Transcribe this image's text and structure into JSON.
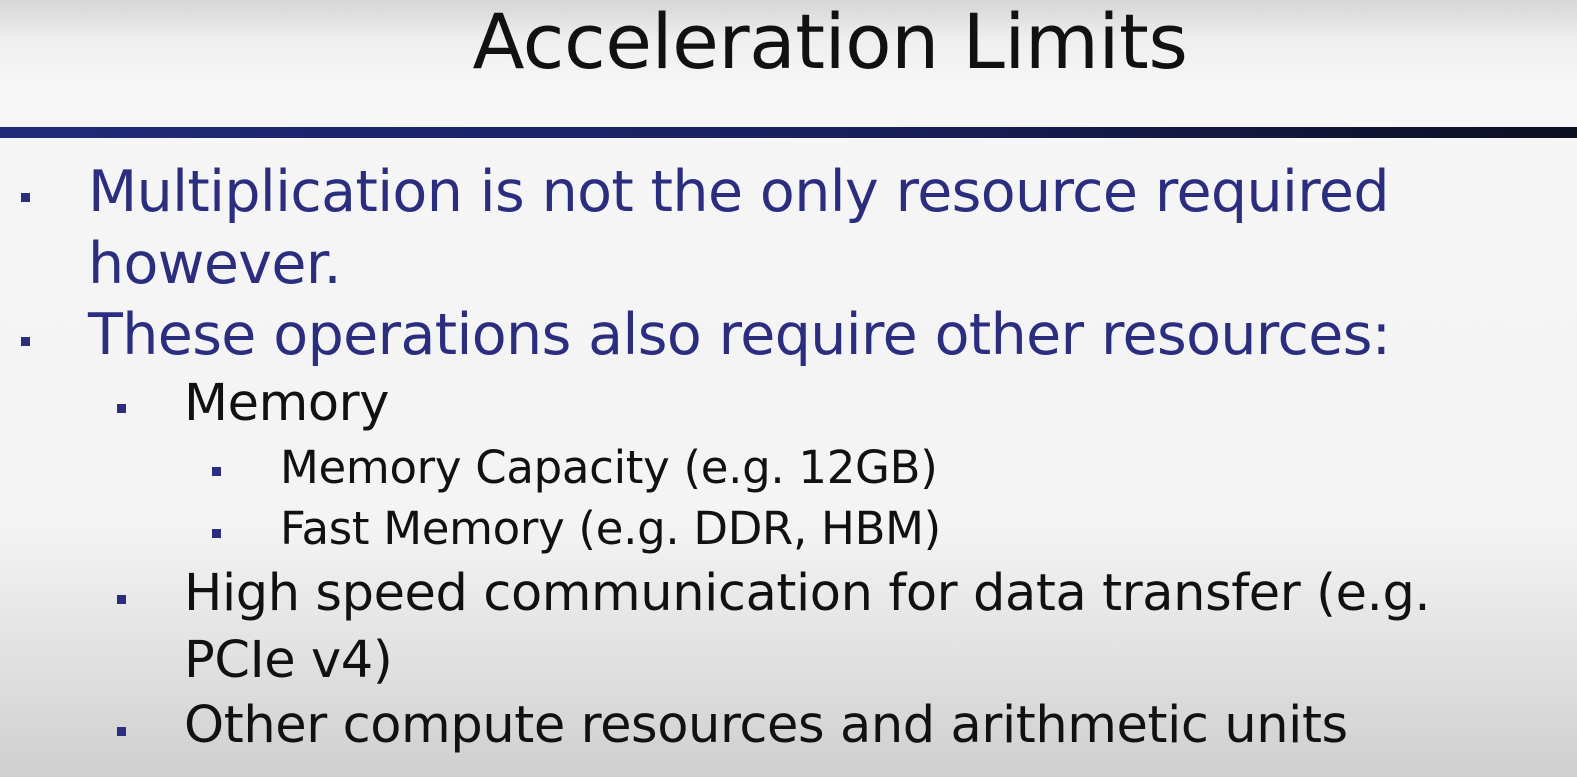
{
  "slide": {
    "title": "Acceleration Limits",
    "bullets": [
      {
        "level": 1,
        "line1": "Multiplication is not the only resource required",
        "line2": "however."
      },
      {
        "level": 1,
        "line1": "These operations also require other resources:"
      },
      {
        "level": 2,
        "line1": "Memory"
      },
      {
        "level": 3,
        "line1": "Memory Capacity (e.g. 12GB)"
      },
      {
        "level": 3,
        "line1": "Fast Memory (e.g. DDR, HBM)"
      },
      {
        "level": 2,
        "line1": "High speed communication for data transfer (e.g.",
        "line2": "PCIe v4)"
      },
      {
        "level": 2,
        "line1": "Other compute resources and arithmetic units"
      }
    ]
  },
  "colors": {
    "accent_blue": "#2b2e7f",
    "text_black": "#111111",
    "rule_blue": "#1f2a7a"
  }
}
